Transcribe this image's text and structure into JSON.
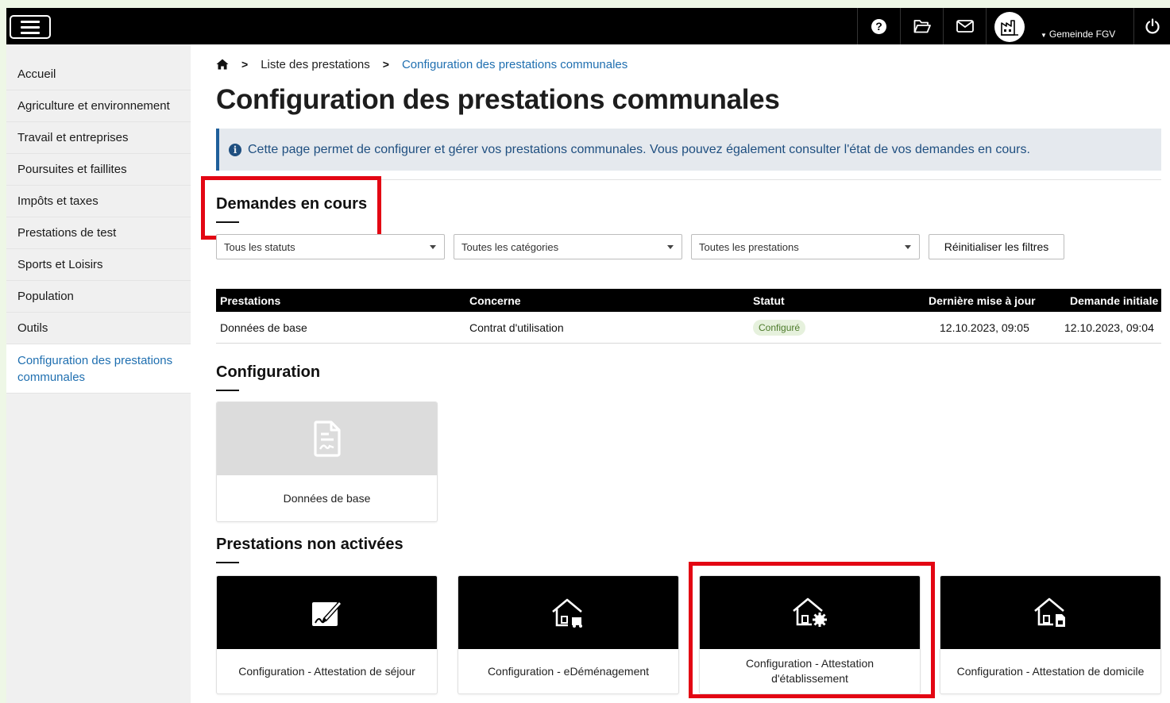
{
  "topbar": {
    "user_name": "Gemeinde FGV"
  },
  "sidebar": {
    "items": [
      {
        "label": "Accueil"
      },
      {
        "label": "Agriculture et environnement"
      },
      {
        "label": "Travail et entreprises"
      },
      {
        "label": "Poursuites et faillites"
      },
      {
        "label": "Impôts et taxes"
      },
      {
        "label": "Prestations de test"
      },
      {
        "label": "Sports et Loisirs"
      },
      {
        "label": "Population"
      },
      {
        "label": "Outils"
      },
      {
        "label": "Configuration des prestations communales"
      }
    ]
  },
  "breadcrumb": {
    "home_icon": "home-icon",
    "items": [
      "Liste des prestations",
      "Configuration des prestations communales"
    ]
  },
  "page": {
    "title": "Configuration des prestations communales",
    "info": "Cette page permet de configurer et gérer vos prestations communales. Vous pouvez également consulter l'état de vos demandes en cours."
  },
  "requests": {
    "title": "Demandes en cours",
    "filters": {
      "status": "Tous les statuts",
      "category": "Toutes les catégories",
      "service": "Toutes les prestations",
      "reset": "Réinitialiser les filtres"
    },
    "columns": [
      "Prestations",
      "Concerne",
      "Statut",
      "Dernière mise à jour",
      "Demande initiale"
    ],
    "rows": [
      {
        "prestation": "Données de base",
        "concerne": "Contrat d'utilisation",
        "statut": "Configuré",
        "updated": "12.10.2023, 09:05",
        "initial": "12.10.2023, 09:04"
      }
    ]
  },
  "configuration": {
    "title": "Configuration",
    "cards": [
      {
        "label": "Données de base",
        "icon": "document-icon"
      }
    ]
  },
  "inactive": {
    "title": "Prestations non activées",
    "cards": [
      {
        "label": "Configuration - Attestation de séjour",
        "icon": "signature-edit-icon"
      },
      {
        "label": "Configuration - eDéménagement",
        "icon": "house-moving-icon"
      },
      {
        "label": "Configuration - Attestation d'établissement",
        "icon": "house-gear-icon"
      },
      {
        "label": "Configuration - Attestation de domicile",
        "icon": "house-document-icon"
      }
    ]
  },
  "colors": {
    "accent": "#1f6fb0",
    "highlight": "#e30613",
    "topbar": "#000000",
    "status_badge_bg": "#e6f1dd"
  }
}
